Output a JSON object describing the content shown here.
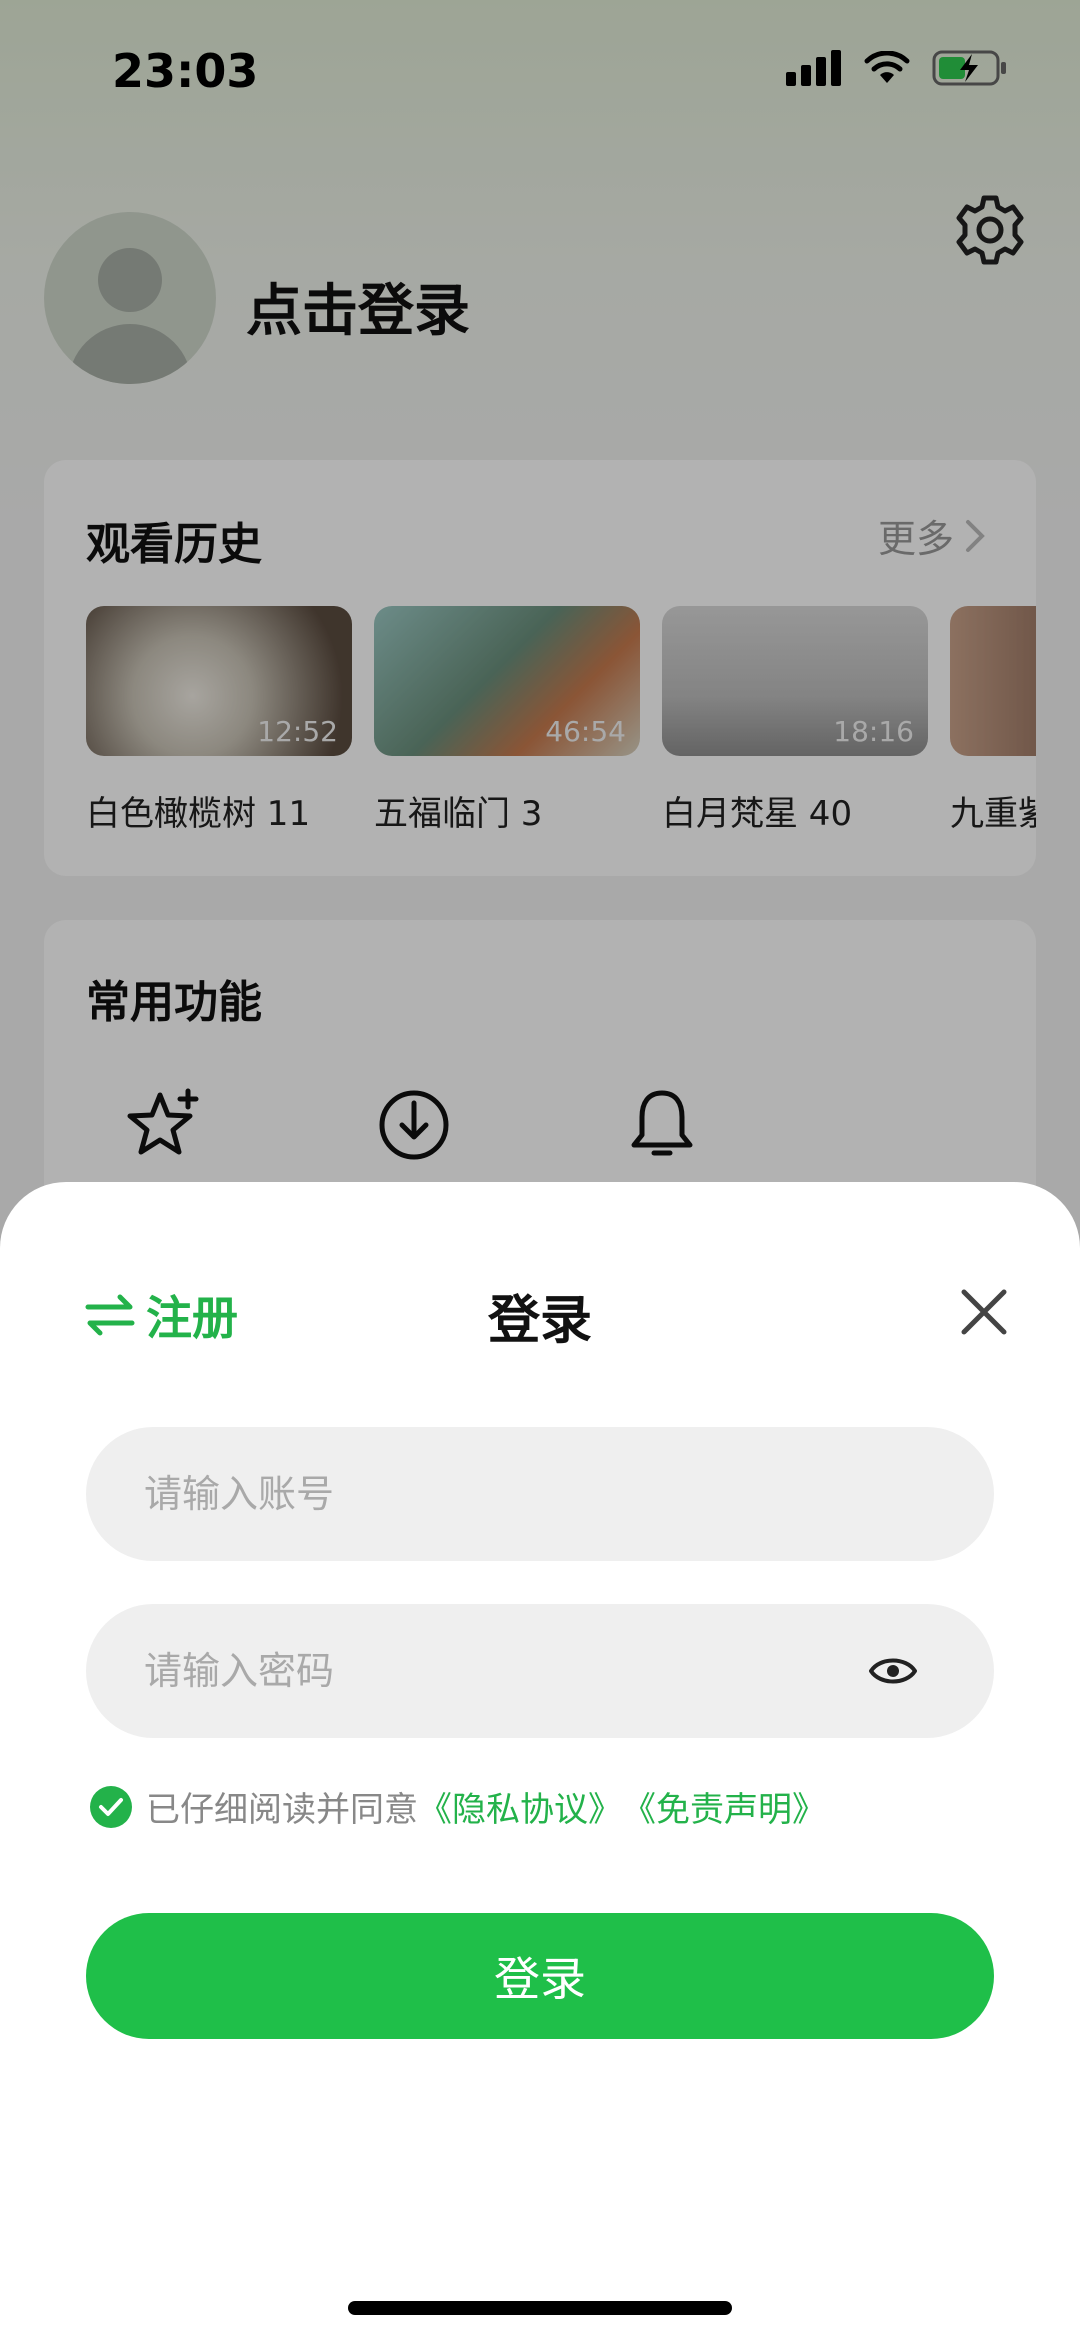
{
  "status_bar": {
    "time": "23:03"
  },
  "profile": {
    "login_prompt": "点击登录"
  },
  "history": {
    "title": "观看历史",
    "more_label": "更多",
    "items": [
      {
        "title": "白色橄榄树 11",
        "duration": "12:52"
      },
      {
        "title": "五福临门 3",
        "duration": "46:54"
      },
      {
        "title": "白月梵星 40",
        "duration": "18:16"
      },
      {
        "title": "九重紫",
        "duration": ""
      }
    ]
  },
  "functions": {
    "title": "常用功能",
    "icons": [
      "star-plus-icon",
      "download-icon",
      "bell-icon"
    ]
  },
  "login_sheet": {
    "register_label": "注册",
    "title": "登录",
    "account_placeholder": "请输入账号",
    "password_placeholder": "请输入密码",
    "agree_text": "已仔细阅读并同意",
    "privacy_link": "《隐私协议》",
    "disclaimer_link": "《免责声明》",
    "login_button": "登录"
  },
  "colors": {
    "accent": "#1fbf49",
    "accent_text": "#23b24a"
  }
}
